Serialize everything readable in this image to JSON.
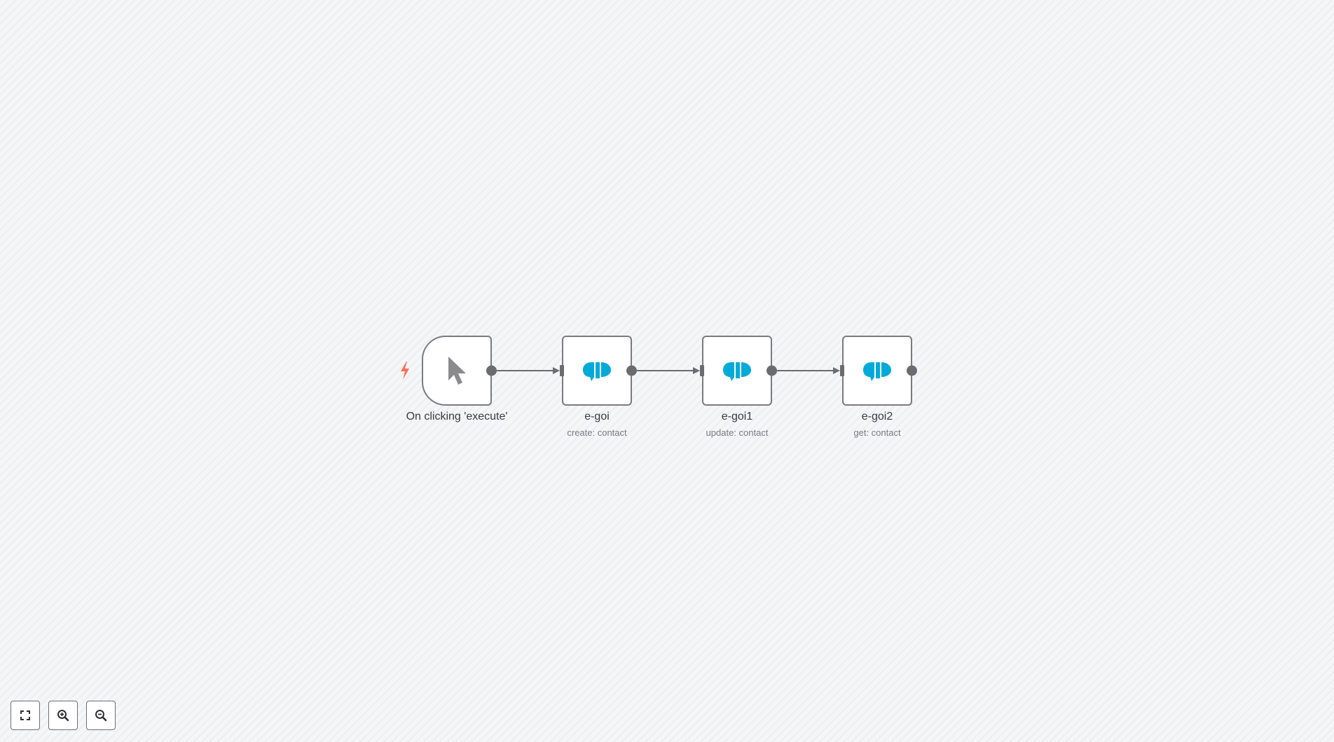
{
  "nodes": [
    {
      "id": "trigger",
      "label": "On clicking 'execute'",
      "subtitle": "",
      "icon": "mouse-pointer-icon",
      "kind": "trigger"
    },
    {
      "id": "egoi",
      "label": "e-goi",
      "subtitle": "create: contact",
      "icon": "egoi-logo-icon",
      "kind": "action"
    },
    {
      "id": "egoi1",
      "label": "e-goi1",
      "subtitle": "update: contact",
      "icon": "egoi-logo-icon",
      "kind": "action"
    },
    {
      "id": "egoi2",
      "label": "e-goi2",
      "subtitle": "get: contact",
      "icon": "egoi-logo-icon",
      "kind": "action"
    }
  ],
  "connections": [
    {
      "from": "trigger",
      "to": "egoi"
    },
    {
      "from": "egoi",
      "to": "egoi1"
    },
    {
      "from": "egoi1",
      "to": "egoi2"
    }
  ],
  "controls": {
    "fit_icon": "fullscreen-icon",
    "zoom_in_icon": "zoom-in-icon",
    "zoom_out_icon": "zoom-out-icon"
  },
  "colors": {
    "egoi_brand": "#00aad8",
    "trigger_bolt": "#ff6d5a",
    "node_border": "#7a7a7f",
    "handle": "#6b6b70"
  }
}
